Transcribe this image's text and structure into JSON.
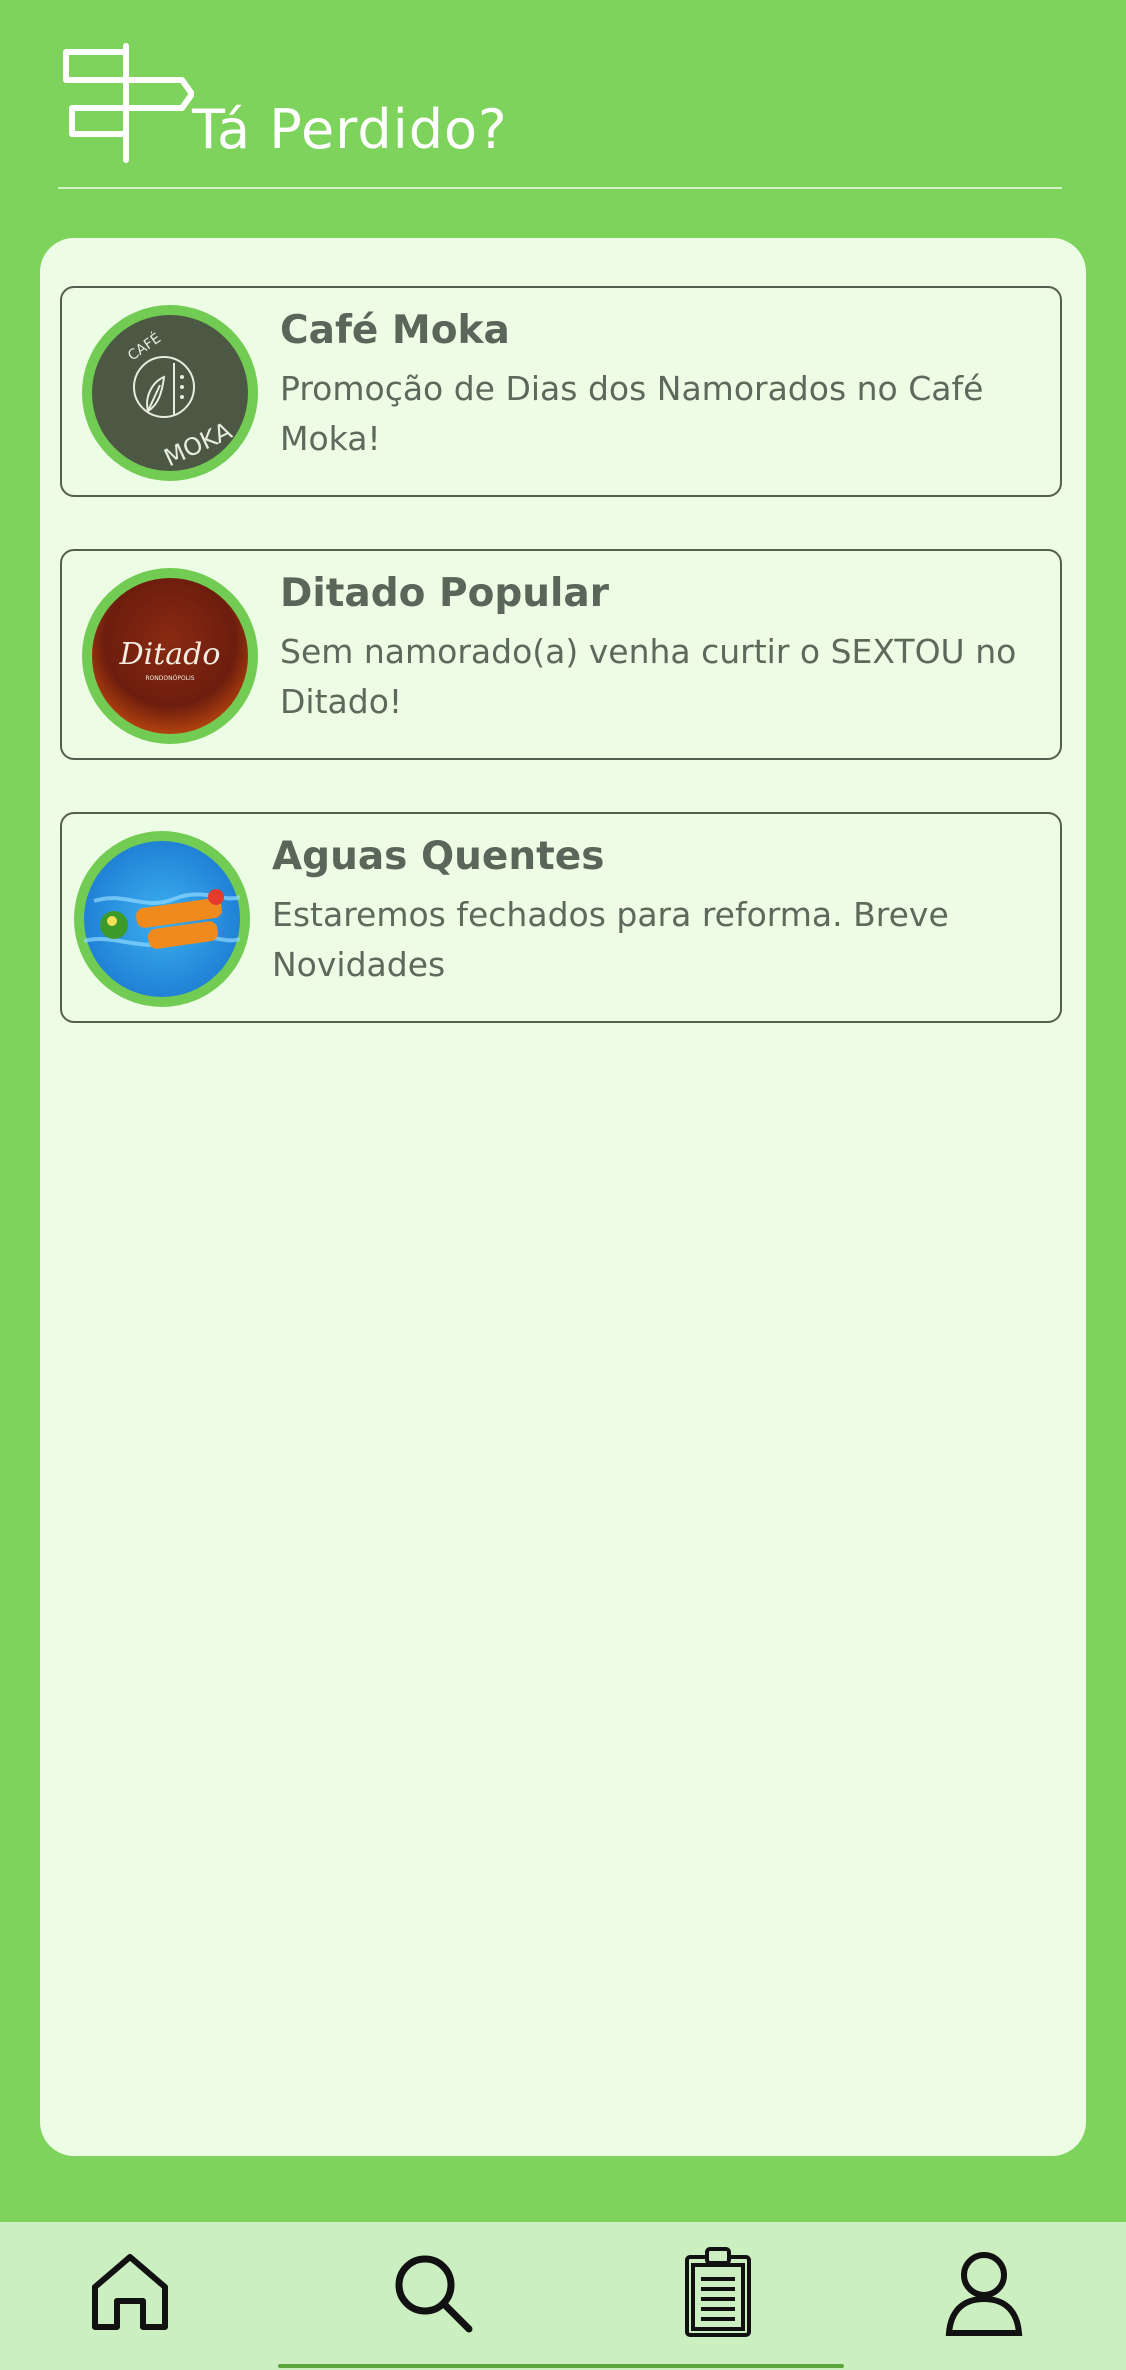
{
  "header": {
    "title": "Tá Perdido?",
    "logo_icon": "signpost-icon"
  },
  "cards": [
    {
      "name": "Café Moka",
      "description": "Promoção de Dias dos Namorados no Café Moka!",
      "avatar_icon": "cafe-moka-logo",
      "logo_text_top": "CAFÉ",
      "logo_text_bottom": "MOKA"
    },
    {
      "name": "Ditado Popular",
      "description": "Sem namorado(a) venha curtir o SEXTOU no Ditado!",
      "avatar_icon": "ditado-logo",
      "logo_text_main": "Ditado",
      "logo_text_sub": "RONDONÓPOLIS"
    },
    {
      "name": "Aguas Quentes",
      "description": "Estaremos fechados para reforma. Breve Novidades",
      "avatar_icon": "aguas-quentes-logo"
    }
  ],
  "nav": {
    "items": [
      {
        "icon": "home-icon"
      },
      {
        "icon": "search-icon"
      },
      {
        "icon": "clipboard-icon"
      },
      {
        "icon": "profile-icon"
      }
    ]
  },
  "colors": {
    "primary_green": "#7dd35c",
    "panel_bg": "#edfde5",
    "nav_bg": "#cbefc0",
    "text": "#5a6659"
  }
}
